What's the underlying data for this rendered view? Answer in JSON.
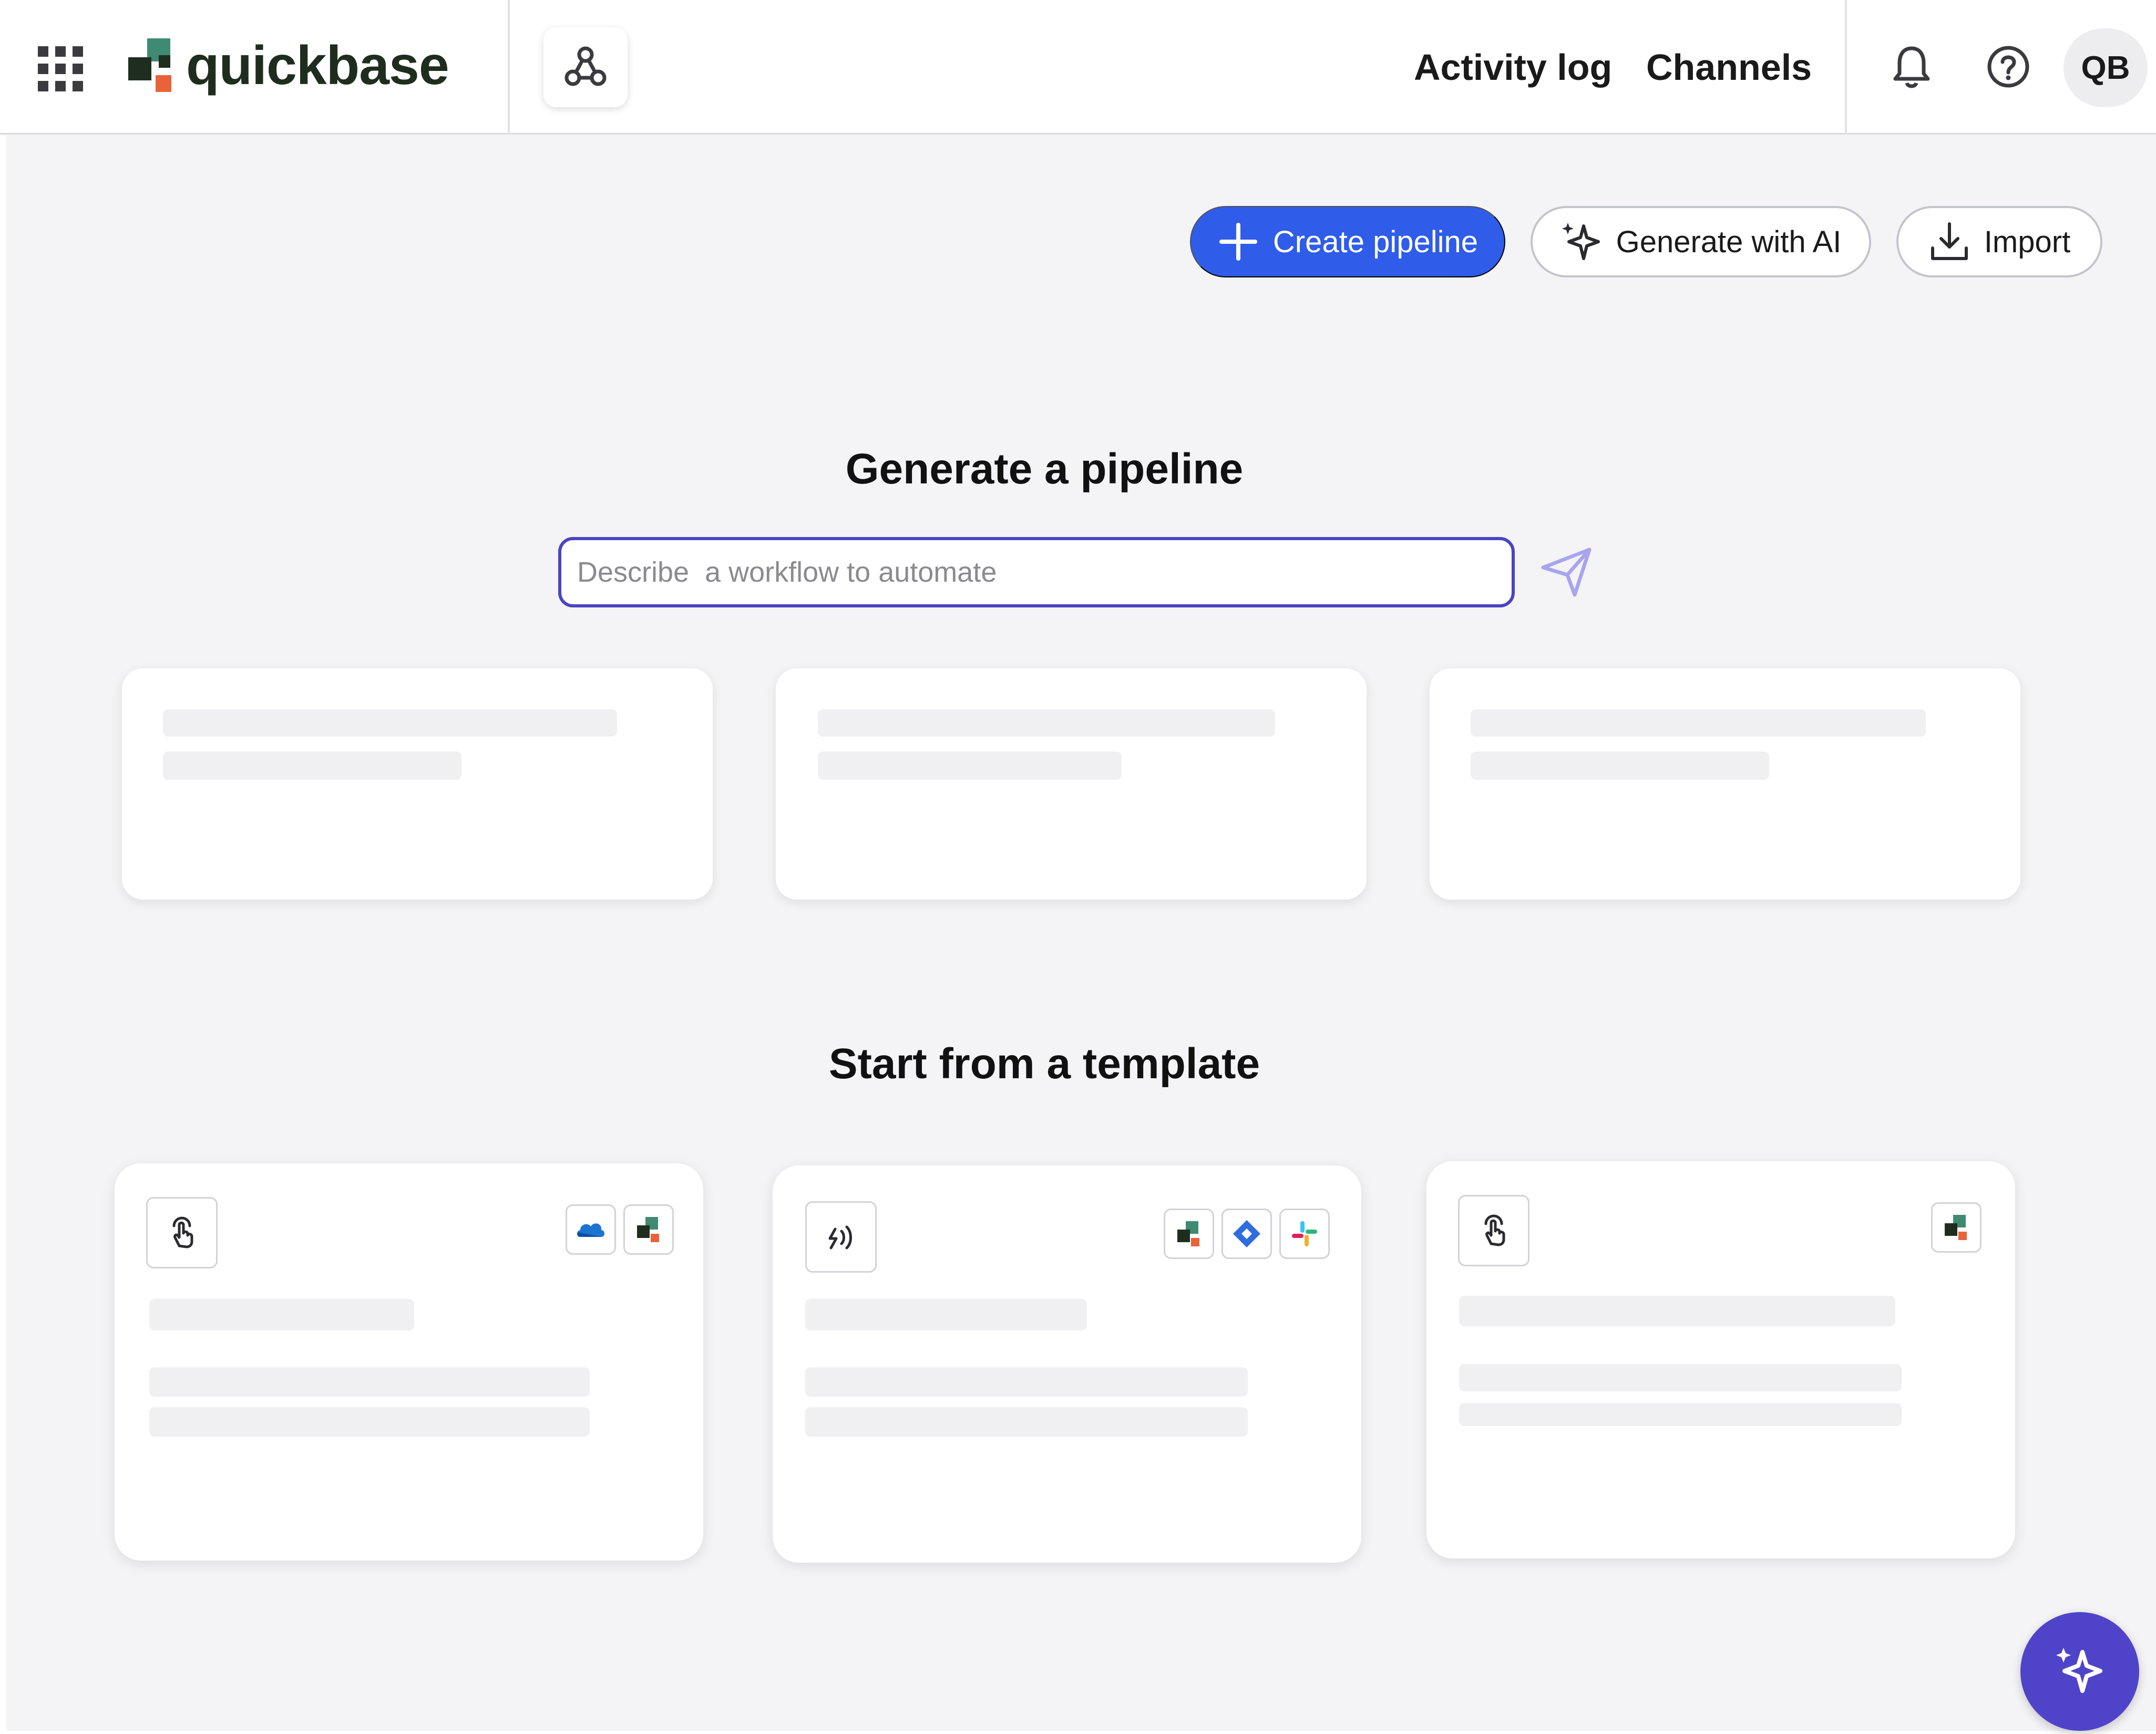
{
  "header": {
    "apps_icon": "grid-icon",
    "logo_text": "quickbase",
    "pipelines_icon": "pipelines-nodes-icon",
    "nav": [
      {
        "label": "Activity log"
      },
      {
        "label": "Channels"
      }
    ],
    "notifications_icon": "bell-icon",
    "help_icon": "help-circle-icon",
    "avatar_initials": "QB"
  },
  "actions": {
    "create_label": "Create pipeline",
    "create_icon": "plus-icon",
    "generate_label": "Generate with AI",
    "generate_icon": "sparkle-icon",
    "import_label": "Import",
    "import_icon": "download-icon"
  },
  "generate": {
    "title": "Generate a pipeline",
    "placeholder": "Describe  a workflow to automate",
    "value": "",
    "send_icon": "send-icon"
  },
  "templates": {
    "title": "Start from a template",
    "cards": [
      {
        "trigger_icon": "tap-hand-icon",
        "services": [
          "onedrive-icon",
          "quickbase-icon"
        ]
      },
      {
        "trigger_icon": "webhook-signal-icon",
        "services": [
          "quickbase-icon",
          "jira-icon",
          "slack-icon"
        ]
      },
      {
        "trigger_icon": "tap-hand-icon",
        "services": [
          "quickbase-icon"
        ]
      }
    ]
  },
  "fab_icon": "sparkle-icon",
  "colors": {
    "brand_blue": "#2f5ce8",
    "accent_purple": "#4f44c9",
    "input_border": "#4a44c2",
    "background": "#f4f4f6"
  }
}
